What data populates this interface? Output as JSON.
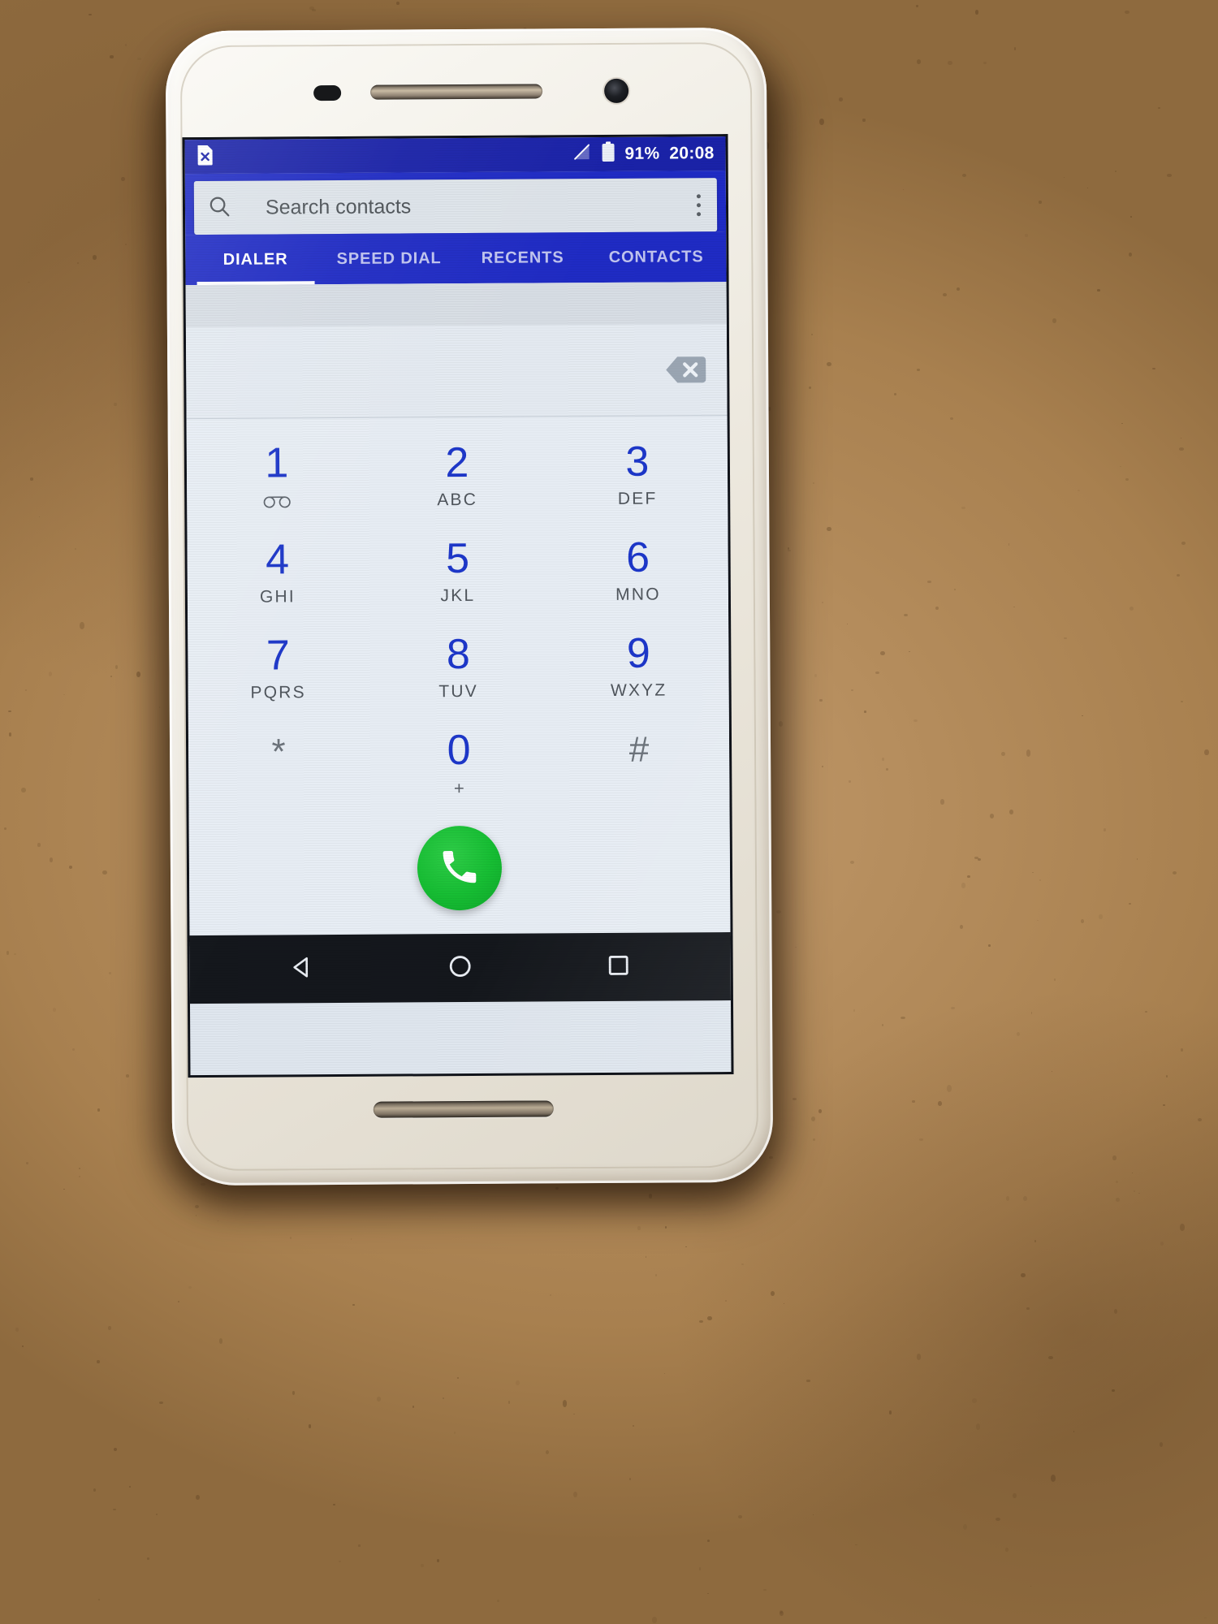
{
  "device": {
    "type": "white-android-smartphone",
    "surface": "cork-desk"
  },
  "status_bar": {
    "left_icons": [
      "sim-card-error-icon"
    ],
    "right_icons": [
      "no-signal-icon",
      "battery-icon"
    ],
    "battery_percent": "91%",
    "clock": "20:08",
    "background_color": "#1a22a8",
    "text_color": "#ffffff"
  },
  "app_bar": {
    "background_color": "#1f2bc4",
    "search": {
      "placeholder": "Search contacts",
      "icon": "search-icon",
      "value": ""
    },
    "overflow_icon": "kebab-menu-icon"
  },
  "tabs": {
    "items": [
      {
        "label": "DIALER",
        "active": true
      },
      {
        "label": "SPEED DIAL",
        "active": false
      },
      {
        "label": "RECENTS",
        "active": false
      },
      {
        "label": "CONTACTS",
        "active": false
      }
    ],
    "indicator_color": "#ffffff"
  },
  "dial_entry": {
    "number": "",
    "backspace_icon": "backspace-delete-icon"
  },
  "keypad": {
    "accent_color": "#1d37c9",
    "background_color": "#e7edf4",
    "rows": [
      [
        {
          "digit": "1",
          "sub": "",
          "icon": "voicemail-icon",
          "symbol": false
        },
        {
          "digit": "2",
          "sub": "ABC",
          "icon": "",
          "symbol": false
        },
        {
          "digit": "3",
          "sub": "DEF",
          "icon": "",
          "symbol": false
        }
      ],
      [
        {
          "digit": "4",
          "sub": "GHI",
          "icon": "",
          "symbol": false
        },
        {
          "digit": "5",
          "sub": "JKL",
          "icon": "",
          "symbol": false
        },
        {
          "digit": "6",
          "sub": "MNO",
          "icon": "",
          "symbol": false
        }
      ],
      [
        {
          "digit": "7",
          "sub": "PQRS",
          "icon": "",
          "symbol": false
        },
        {
          "digit": "8",
          "sub": "TUV",
          "icon": "",
          "symbol": false
        },
        {
          "digit": "9",
          "sub": "WXYZ",
          "icon": "",
          "symbol": false
        }
      ],
      [
        {
          "digit": "*",
          "sub": "",
          "icon": "",
          "symbol": true
        },
        {
          "digit": "0",
          "sub": "+",
          "icon": "",
          "symbol": false
        },
        {
          "digit": "#",
          "sub": "",
          "icon": "",
          "symbol": true
        }
      ]
    ]
  },
  "call_button": {
    "icon": "phone-handset-icon",
    "color": "#16bd33"
  },
  "nav_bar": {
    "background_color": "#14171c",
    "buttons": [
      {
        "name": "back",
        "icon": "back-triangle-icon"
      },
      {
        "name": "home",
        "icon": "home-circle-icon"
      },
      {
        "name": "recents",
        "icon": "recents-square-icon"
      }
    ]
  }
}
